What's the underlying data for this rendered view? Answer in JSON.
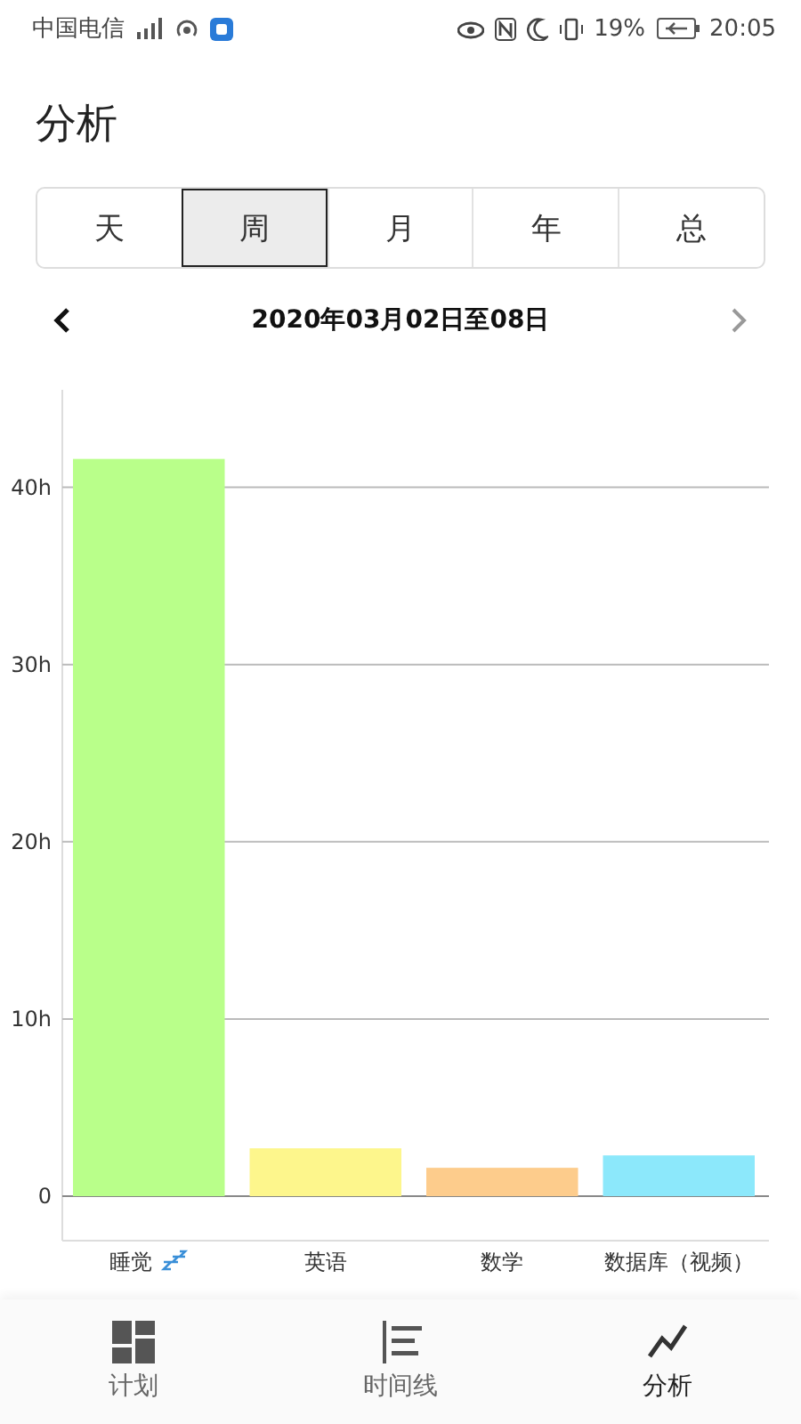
{
  "status_bar": {
    "carrier": "中国电信",
    "battery": "19%",
    "time": "20:05"
  },
  "title": "分析",
  "tabs": [
    {
      "label": "天",
      "selected": false
    },
    {
      "label": "周",
      "selected": true
    },
    {
      "label": "月",
      "selected": false
    },
    {
      "label": "年",
      "selected": false
    },
    {
      "label": "总",
      "selected": false
    }
  ],
  "date_range": "2020年03月02日至08日",
  "chart_data": {
    "type": "bar",
    "grid": true,
    "series": [
      {
        "name": "睡觉",
        "color": "#b9ff8a",
        "values": [
          41.6,
          null,
          null,
          null
        ]
      },
      {
        "name": "英语",
        "color": "#fdf68c",
        "values": [
          null,
          2.7,
          null,
          null
        ]
      },
      {
        "name": "数学",
        "color": "#fdcc8c",
        "values": [
          null,
          null,
          1.6,
          null
        ]
      },
      {
        "name": "数据库（视频）",
        "color": "#8ce8fb",
        "values": [
          null,
          null,
          null,
          2.3
        ]
      }
    ],
    "ylim": [
      0,
      45.5
    ],
    "yticks": [
      {
        "value": 0,
        "label": "0"
      },
      {
        "value": 10,
        "label": "10h"
      },
      {
        "value": 20,
        "label": "20h"
      },
      {
        "value": 30,
        "label": "30h"
      },
      {
        "value": 40,
        "label": "40h"
      }
    ]
  },
  "nav": [
    {
      "label": "计划",
      "kind": "grid",
      "selected": false
    },
    {
      "label": "时间线",
      "kind": "timeline",
      "selected": false
    },
    {
      "label": "分析",
      "kind": "chart",
      "selected": true
    }
  ]
}
